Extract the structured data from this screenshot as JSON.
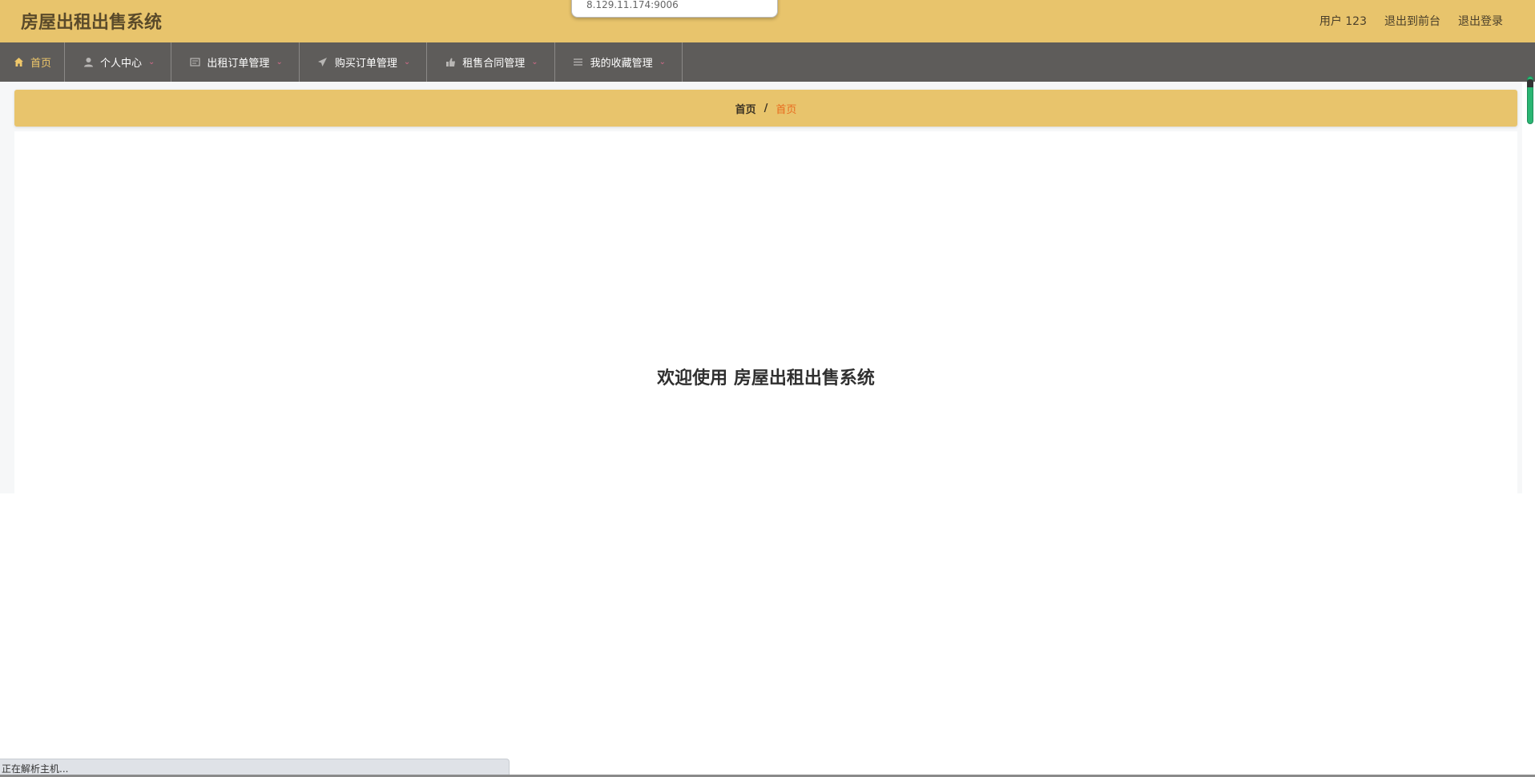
{
  "header": {
    "title": "房屋出租出售系统",
    "links": [
      "用户 123",
      "退出到前台",
      "退出登录"
    ]
  },
  "url_popup": "8.129.11.174:9006",
  "nav": {
    "items": [
      {
        "label": "首页",
        "icon": "home-icon",
        "active": true
      },
      {
        "label": "个人中心",
        "icon": "user-icon"
      },
      {
        "label": "出租订单管理",
        "icon": "list-icon"
      },
      {
        "label": "购买订单管理",
        "icon": "send-icon"
      },
      {
        "label": "租售合同管理",
        "icon": "thumb-icon"
      },
      {
        "label": "我的收藏管理",
        "icon": "menu-icon"
      }
    ]
  },
  "breadcrumb": {
    "home": "首页",
    "separator": "/",
    "current": "首页"
  },
  "welcome": "欢迎使用 房屋出租出售系统",
  "status": "正在解析主机...",
  "colors": {
    "header_bg": "#e8c46c",
    "nav_bg": "#5e5c5a",
    "active_nav_text": "#f0c86a",
    "breadcrumb_current": "#e96b1e",
    "scrollbar": "#2bb673"
  }
}
